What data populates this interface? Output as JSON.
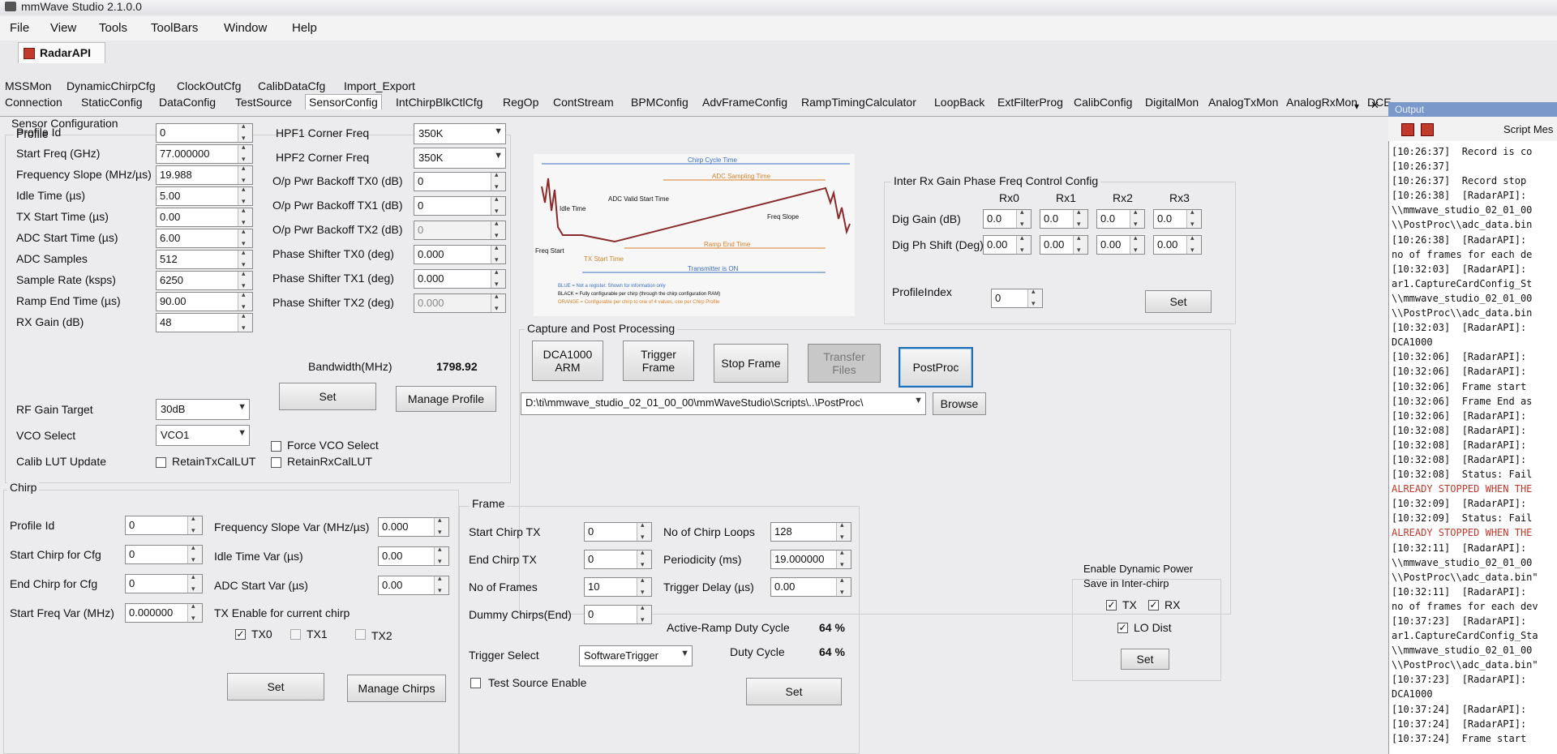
{
  "app": {
    "title": "mmWave Studio 2.1.0.0"
  },
  "menu": [
    "File",
    "View",
    "Tools",
    "ToolBars",
    "Window",
    "Help"
  ],
  "doc_tab": "RadarAPI",
  "tabs_row1": [
    "MSSMon",
    "DynamicChirpCfg",
    "ClockOutCfg",
    "CalibDataCfg",
    "Import_Export"
  ],
  "tabs_row2": [
    "Connection",
    "StaticConfig",
    "DataConfig",
    "TestSource",
    "SensorConfig",
    "IntChirpBlkCtlCfg",
    "RegOp",
    "ContStream",
    "BPMConfig",
    "AdvFrameConfig",
    "RampTimingCalculator",
    "LoopBack",
    "ExtFilterProg",
    "CalibConfig",
    "DigitalMon",
    "AnalogTxMon",
    "AnalogRxMon",
    "DCE"
  ],
  "tabs_controls": {
    "dropdown": "▾",
    "close": "✕"
  },
  "sensor_config_title": "Sensor Configuration",
  "profile": {
    "title": "Profile",
    "fields": [
      {
        "label": "Profile Id",
        "value": "0"
      },
      {
        "label": "Start Freq (GHz)",
        "value": "77.000000"
      },
      {
        "label": "Frequency Slope (MHz/µs)",
        "value": "19.988"
      },
      {
        "label": "Idle Time (µs)",
        "value": "5.00"
      },
      {
        "label": "TX Start Time (µs)",
        "value": "0.00"
      },
      {
        "label": "ADC Start Time (µs)",
        "value": "6.00"
      },
      {
        "label": "ADC Samples",
        "value": "512"
      },
      {
        "label": "Sample Rate (ksps)",
        "value": "6250"
      },
      {
        "label": "Ramp End Time (µs)",
        "value": "90.00"
      },
      {
        "label": "RX Gain (dB)",
        "value": "48"
      }
    ],
    "rf_gain_target": {
      "label": "RF Gain Target",
      "value": "30dB"
    },
    "vco_select": {
      "label": "VCO Select",
      "value": "VCO1"
    },
    "calib_lut": {
      "label": "Calib LUT Update",
      "retain_tx": "RetainTxCalLUT",
      "retain_rx": "RetainRxCalLUT"
    },
    "hpf1": {
      "label": "HPF1 Corner Freq",
      "value": "350K"
    },
    "hpf2": {
      "label": "HPF2 Corner Freq",
      "value": "350K"
    },
    "right_fields": [
      {
        "label": "O/p Pwr Backoff TX0 (dB)",
        "value": "0"
      },
      {
        "label": "O/p Pwr Backoff TX1 (dB)",
        "value": "0"
      },
      {
        "label": "O/p Pwr Backoff TX2 (dB)",
        "value": "0"
      },
      {
        "label": "Phase Shifter TX0 (deg)",
        "value": "0.000"
      },
      {
        "label": "Phase Shifter TX1 (deg)",
        "value": "0.000"
      },
      {
        "label": "Phase Shifter TX2 (deg)",
        "value": "0.000"
      }
    ],
    "bandwidth_label": "Bandwidth(MHz)",
    "bandwidth_value": "1798.92",
    "set_label": "Set",
    "manage_label": "Manage Profile",
    "force_vco": "Force VCO Select"
  },
  "diagram": {
    "chirp_cycle": "Chirp Cycle Time",
    "adc_sampling": "ADC Sampling Time",
    "adc_valid": "ADC Valid Start Time",
    "idle_time": "Idle Time",
    "freq_slope": "Freq Slope",
    "ramp_end": "Ramp End Time",
    "freq_start": "Freq Start",
    "tx_start": "TX Start Time",
    "transmitter_on": "Transmitter is ON",
    "legend_blue": "BLUE = Not a register. Shown for information only",
    "legend_black": "BLACK = Fully configurable per chirp (through the chirp configuration RAM)",
    "legend_orange": "ORANGE = Configurable per chirp to one of 4 values, one per Chirp Profile"
  },
  "inter_rx": {
    "title": "Inter Rx Gain Phase Freq Control Config",
    "cols": [
      "Rx0",
      "Rx1",
      "Rx2",
      "Rx3"
    ],
    "dig_gain_label": "Dig Gain (dB)",
    "dig_gain": [
      "0.0",
      "0.0",
      "0.0",
      "0.0"
    ],
    "dig_ph_label": "Dig Ph Shift (Deg)",
    "dig_ph": [
      "0.00",
      "0.00",
      "0.00",
      "0.00"
    ],
    "profile_index_label": "ProfileIndex",
    "profile_index": "0",
    "set_label": "Set"
  },
  "capture": {
    "title": "Capture and Post Processing",
    "dca_label": "DCA1000\nARM",
    "trigger_label": "Trigger\nFrame",
    "stop_label": "Stop Frame",
    "transfer_label": "Transfer\nFiles",
    "postproc_label": "PostProc",
    "path": "D:\\ti\\mmwave_studio_02_01_00_00\\mmWaveStudio\\Scripts\\..\\PostProc\\",
    "browse_label": "Browse"
  },
  "chirp": {
    "title": "Chirp",
    "left_fields": [
      {
        "label": "Profile Id",
        "value": "0"
      },
      {
        "label": "Start Chirp for Cfg",
        "value": "0"
      },
      {
        "label": "End Chirp for Cfg",
        "value": "0"
      },
      {
        "label": "Start Freq Var (MHz)",
        "value": "0.000000"
      }
    ],
    "right_fields": [
      {
        "label": "Frequency Slope Var (MHz/µs)",
        "value": "0.000"
      },
      {
        "label": "Idle Time Var (µs)",
        "value": "0.00"
      },
      {
        "label": "ADC Start Var (µs)",
        "value": "0.00"
      }
    ],
    "tx_enable_label": "TX Enable for current chirp",
    "tx0": "TX0",
    "tx1": "TX1",
    "tx2": "TX2",
    "set_label": "Set",
    "manage_label": "Manage Chirps"
  },
  "frame": {
    "title": "Frame",
    "left_fields": [
      {
        "label": "Start Chirp TX",
        "value": "0"
      },
      {
        "label": "End Chirp TX",
        "value": "0"
      },
      {
        "label": "No of Frames",
        "value": "10"
      },
      {
        "label": "Dummy Chirps(End)",
        "value": "0"
      }
    ],
    "right_fields": [
      {
        "label": "No of Chirp Loops",
        "value": "128"
      },
      {
        "label": "Periodicity (ms)",
        "value": "19.000000"
      },
      {
        "label": "Trigger Delay (µs)",
        "value": "0.00"
      }
    ],
    "active_ramp_label": "Active-Ramp Duty Cycle",
    "active_ramp_value": "64 %",
    "duty_cycle_label": "Duty Cycle",
    "duty_cycle_value": "64 %",
    "trigger_select_label": "Trigger Select",
    "trigger_select_value": "SoftwareTrigger",
    "test_source_label": "Test Source Enable",
    "set_label": "Set"
  },
  "dyn_power": {
    "title_line1": "Enable Dynamic Power",
    "title_line2": "Save in Inter-chirp",
    "tx": "TX",
    "rx": "RX",
    "lo_dist": "LO Dist",
    "set_label": "Set"
  },
  "output": {
    "title": "Output",
    "script_label": "Script Mes",
    "lines": [
      {
        "t": "[10:26:37]  Record is co",
        "c": ""
      },
      {
        "t": "[10:26:37]",
        "c": ""
      },
      {
        "t": "[10:26:37]  Record stop",
        "c": ""
      },
      {
        "t": "[10:26:38]  [RadarAPI]:",
        "c": ""
      },
      {
        "t": "\\\\mmwave_studio_02_01_00",
        "c": ""
      },
      {
        "t": "\\\\PostProc\\\\adc_data.bin",
        "c": ""
      },
      {
        "t": "[10:26:38]  [RadarAPI]:",
        "c": ""
      },
      {
        "t": "no of frames for each de",
        "c": ""
      },
      {
        "t": "[10:32:03]  [RadarAPI]:",
        "c": ""
      },
      {
        "t": "ar1.CaptureCardConfig_St",
        "c": ""
      },
      {
        "t": "\\\\mmwave_studio_02_01_00",
        "c": ""
      },
      {
        "t": "\\\\PostProc\\\\adc_data.bin",
        "c": ""
      },
      {
        "t": "[10:32:03]  [RadarAPI]:",
        "c": ""
      },
      {
        "t": "DCA1000",
        "c": ""
      },
      {
        "t": "[10:32:06]  [RadarAPI]:",
        "c": ""
      },
      {
        "t": "[10:32:06]  [RadarAPI]:",
        "c": ""
      },
      {
        "t": "[10:32:06]  Frame start",
        "c": ""
      },
      {
        "t": "[10:32:06]  Frame End as",
        "c": ""
      },
      {
        "t": "[10:32:06]  [RadarAPI]:",
        "c": ""
      },
      {
        "t": "[10:32:08]  [RadarAPI]:",
        "c": ""
      },
      {
        "t": "[10:32:08]  [RadarAPI]:",
        "c": ""
      },
      {
        "t": "[10:32:08]  [RadarAPI]:",
        "c": ""
      },
      {
        "t": "[10:32:08]  Status: Fail",
        "c": ""
      },
      {
        "t": "ALREADY STOPPED WHEN THE",
        "c": "red"
      },
      {
        "t": "[10:32:09]  [RadarAPI]:",
        "c": ""
      },
      {
        "t": "[10:32:09]  Status: Fail",
        "c": ""
      },
      {
        "t": "ALREADY STOPPED WHEN THE",
        "c": "red"
      },
      {
        "t": "[10:32:11]  [RadarAPI]:",
        "c": ""
      },
      {
        "t": "\\\\mmwave_studio_02_01_00",
        "c": ""
      },
      {
        "t": "\\\\PostProc\\\\adc_data.bin\"",
        "c": ""
      },
      {
        "t": "[10:32:11]  [RadarAPI]:",
        "c": ""
      },
      {
        "t": "no of frames for each dev",
        "c": ""
      },
      {
        "t": "[10:37:23]  [RadarAPI]:",
        "c": ""
      },
      {
        "t": "ar1.CaptureCardConfig_Sta",
        "c": ""
      },
      {
        "t": "\\\\mmwave_studio_02_01_00",
        "c": ""
      },
      {
        "t": "\\\\PostProc\\\\adc_data.bin\"",
        "c": ""
      },
      {
        "t": "[10:37:23]  [RadarAPI]:",
        "c": ""
      },
      {
        "t": "DCA1000",
        "c": ""
      },
      {
        "t": "[10:37:24]  [RadarAPI]:",
        "c": ""
      },
      {
        "t": "[10:37:24]  [RadarAPI]:",
        "c": ""
      },
      {
        "t": "[10:37:24]  Frame start",
        "c": ""
      }
    ]
  }
}
